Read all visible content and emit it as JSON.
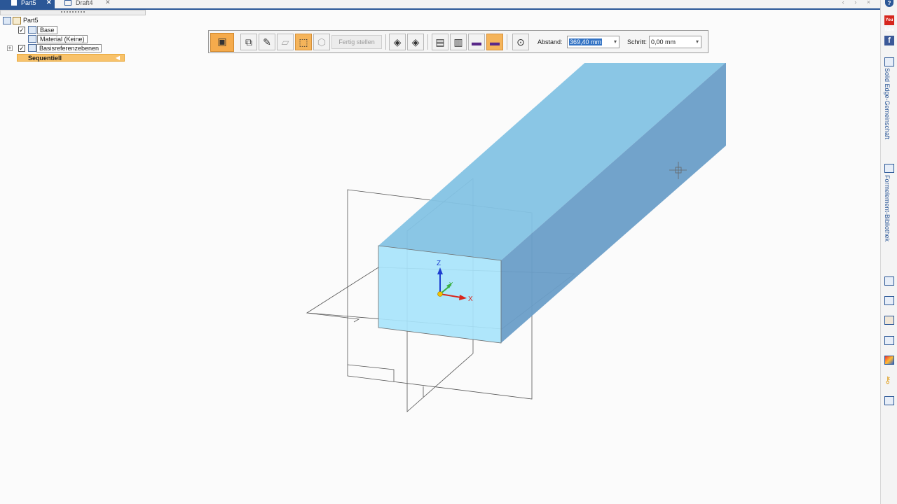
{
  "tabs": [
    {
      "label": "Part5",
      "close": "✕"
    },
    {
      "label": "Draft4",
      "close": "✕"
    }
  ],
  "window_controls": "‹ › ×",
  "tree": {
    "root": "Part5",
    "items": [
      {
        "label": "Base",
        "checked": "✓"
      },
      {
        "label": "Material (Keine)"
      },
      {
        "label": "Basisreferenzebenen",
        "checked": "✓",
        "expander": "+"
      },
      {
        "label": "Sequentiell"
      }
    ]
  },
  "command_bar": {
    "finish_label": "Fertig stellen",
    "distance_label": "Abstand:",
    "distance_value": "369,40 mm",
    "step_label": "Schritt:",
    "step_value": "0,00 mm"
  },
  "triad": {
    "z": "Z",
    "y": "Y",
    "x": "X"
  },
  "right_panel": {
    "help": "?",
    "youtube": "You Tube",
    "facebook": "f",
    "community_label": "Solid Edge-Gemeinschaft",
    "library_label": "Formelement-Bibliothek"
  },
  "colors": {
    "accent": "#2b5797",
    "highlight": "#f8c26a",
    "solid_front": "#a8e4fb",
    "solid_top": "#84c3e4",
    "solid_side": "#6a9ec8",
    "triad_x": "#d9261c",
    "triad_y": "#3cb043",
    "triad_z": "#1e3ed0"
  }
}
